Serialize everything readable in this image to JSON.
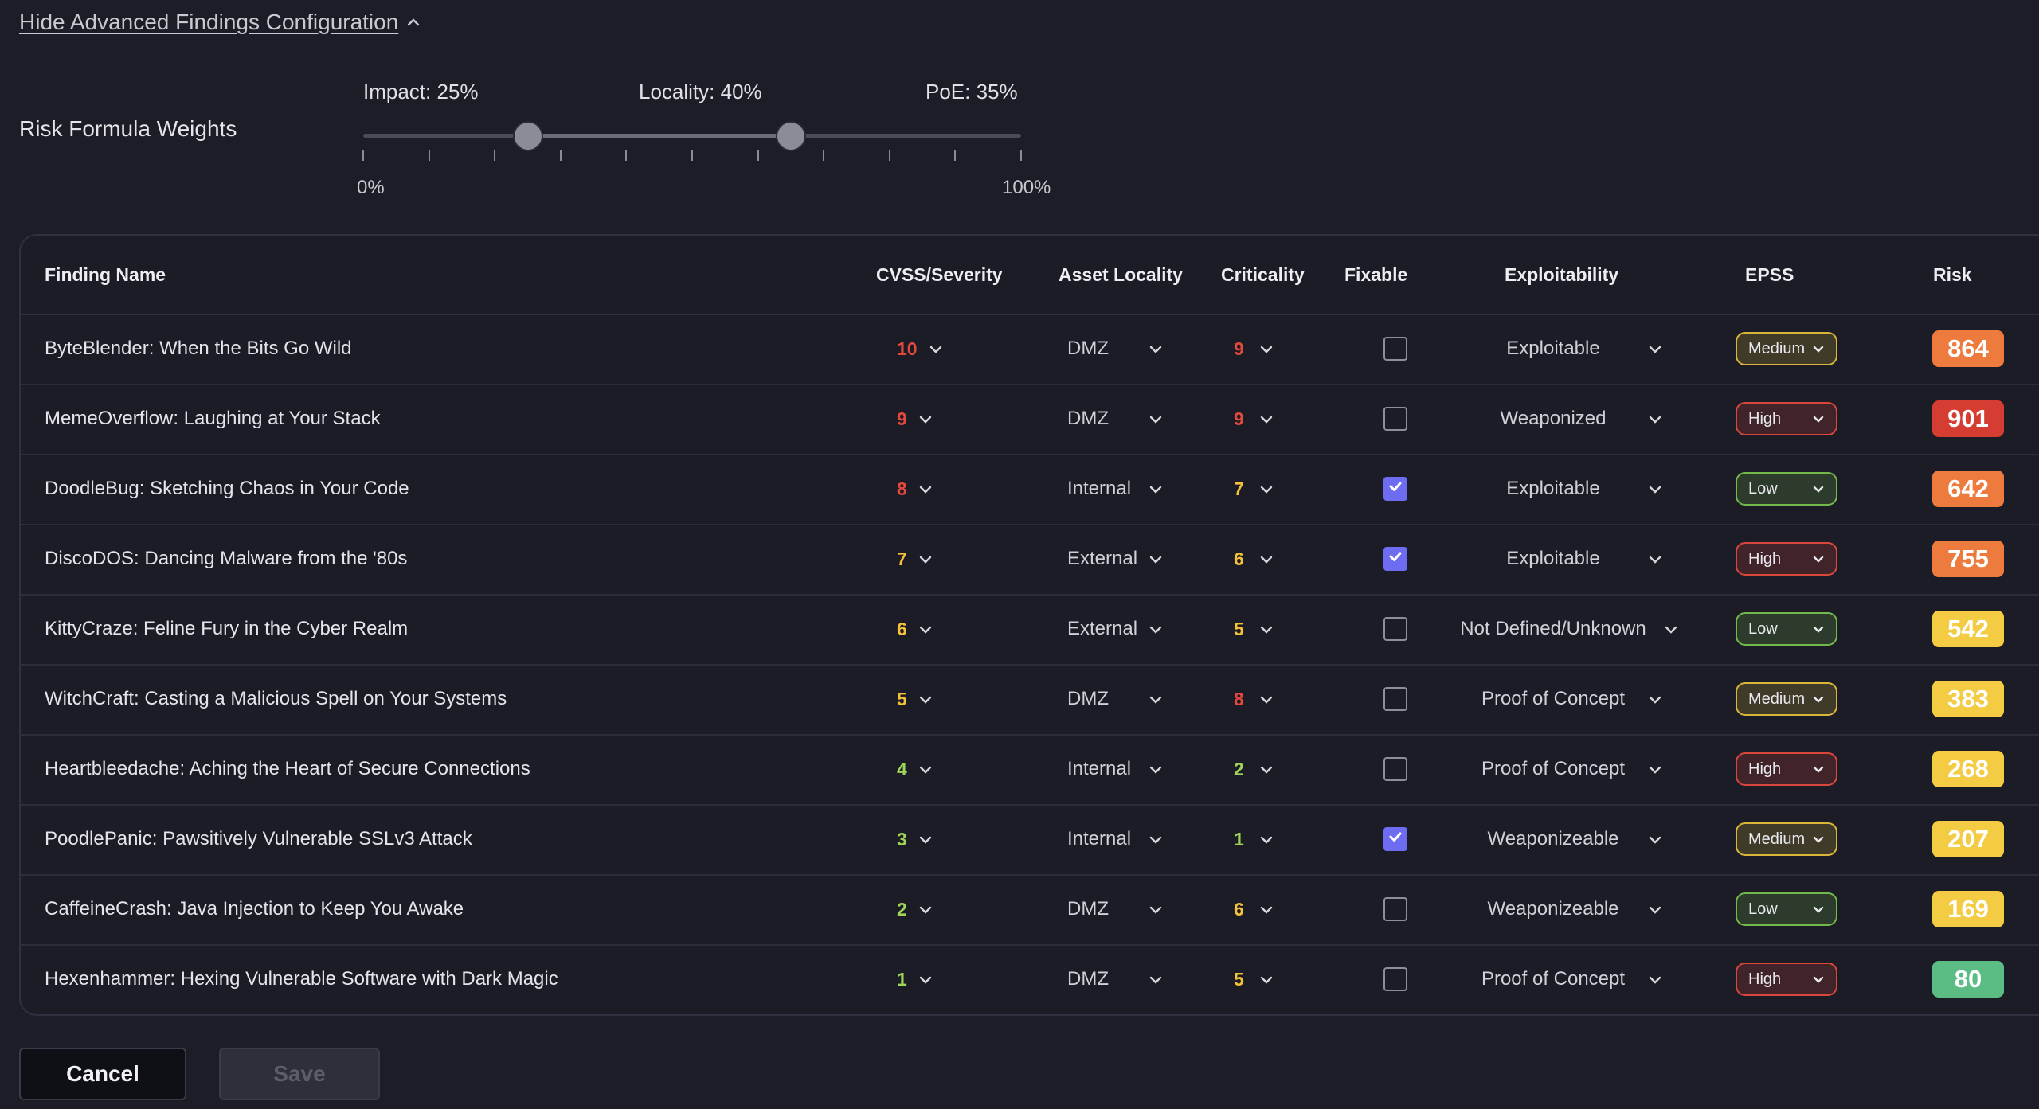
{
  "config_toggle": {
    "label": "Hide Advanced Findings Configuration",
    "icon": "chevron-up-icon"
  },
  "weights": {
    "title": "Risk Formula Weights",
    "impact_label": "Impact: 25%",
    "locality_label": "Locality: 40%",
    "poe_label": "PoE: 35%",
    "impact_pct": 25,
    "locality_pct": 40,
    "poe_pct": 35,
    "scale_min": "0%",
    "scale_max": "100%"
  },
  "columns": {
    "name": "Finding Name",
    "cvss": "CVSS/Severity",
    "locality": "Asset Locality",
    "criticality": "Criticality",
    "fixable": "Fixable",
    "exploitability": "Exploitability",
    "epss": "EPSS",
    "risk": "Risk"
  },
  "colors": {
    "red": "#e5483d",
    "orange": "#f08a3c",
    "yellow": "#f3c13a",
    "green": "#9fd35a",
    "checkbox": "#6e6cf0",
    "epss_medium": "#d9b53a",
    "epss_high": "#d8463c",
    "epss_low": "#72b94a",
    "risk_red": "#d53d33",
    "risk_orange": "#ee7b3e",
    "risk_yellow": "#f4cc43",
    "risk_green": "#5bbd84"
  },
  "findings": [
    {
      "name": "ByteBlender: When the Bits Go Wild",
      "cvss": "10",
      "cvss_color": "red",
      "locality": "DMZ",
      "criticality": "9",
      "crit_color": "red",
      "fixable": false,
      "exploitability": "Exploitable",
      "epss": "Medium",
      "epss_color": "epss_medium",
      "risk": "864",
      "risk_color": "risk_orange"
    },
    {
      "name": "MemeOverflow: Laughing at Your Stack",
      "cvss": "9",
      "cvss_color": "red",
      "locality": "DMZ",
      "criticality": "9",
      "crit_color": "red",
      "fixable": false,
      "exploitability": "Weaponized",
      "epss": "High",
      "epss_color": "epss_high",
      "risk": "901",
      "risk_color": "risk_red"
    },
    {
      "name": "DoodleBug: Sketching Chaos in Your Code",
      "cvss": "8",
      "cvss_color": "red",
      "locality": "Internal",
      "criticality": "7",
      "crit_color": "yellow",
      "fixable": true,
      "exploitability": "Exploitable",
      "epss": "Low",
      "epss_color": "epss_low",
      "risk": "642",
      "risk_color": "risk_orange"
    },
    {
      "name": "DiscoDOS: Dancing Malware from the '80s",
      "cvss": "7",
      "cvss_color": "yellow",
      "locality": "External",
      "criticality": "6",
      "crit_color": "yellow",
      "fixable": true,
      "exploitability": "Exploitable",
      "epss": "High",
      "epss_color": "epss_high",
      "risk": "755",
      "risk_color": "risk_orange"
    },
    {
      "name": "KittyCraze: Feline Fury in the Cyber Realm",
      "cvss": "6",
      "cvss_color": "yellow",
      "locality": "External",
      "criticality": "5",
      "crit_color": "yellow",
      "fixable": false,
      "exploitability": "Not Defined/Unknown",
      "epss": "Low",
      "epss_color": "epss_low",
      "risk": "542",
      "risk_color": "risk_yellow"
    },
    {
      "name": "WitchCraft: Casting a Malicious Spell on Your Systems",
      "cvss": "5",
      "cvss_color": "yellow",
      "locality": "DMZ",
      "criticality": "8",
      "crit_color": "red",
      "fixable": false,
      "exploitability": "Proof of Concept",
      "epss": "Medium",
      "epss_color": "epss_medium",
      "risk": "383",
      "risk_color": "risk_yellow"
    },
    {
      "name": "Heartbleedache: Aching the Heart of Secure Connections",
      "cvss": "4",
      "cvss_color": "green",
      "locality": "Internal",
      "criticality": "2",
      "crit_color": "green",
      "fixable": false,
      "exploitability": "Proof of Concept",
      "epss": "High",
      "epss_color": "epss_high",
      "risk": "268",
      "risk_color": "risk_yellow"
    },
    {
      "name": "PoodlePanic: Pawsitively Vulnerable SSLv3 Attack",
      "cvss": "3",
      "cvss_color": "green",
      "locality": "Internal",
      "criticality": "1",
      "crit_color": "green",
      "fixable": true,
      "exploitability": "Weaponizeable",
      "epss": "Medium",
      "epss_color": "epss_medium",
      "risk": "207",
      "risk_color": "risk_yellow"
    },
    {
      "name": "CaffeineCrash: Java Injection to Keep You Awake",
      "cvss": "2",
      "cvss_color": "green",
      "locality": "DMZ",
      "criticality": "6",
      "crit_color": "yellow",
      "fixable": false,
      "exploitability": "Weaponizeable",
      "epss": "Low",
      "epss_color": "epss_low",
      "risk": "169",
      "risk_color": "risk_yellow"
    },
    {
      "name": "Hexenhammer: Hexing Vulnerable Software with Dark Magic",
      "cvss": "1",
      "cvss_color": "green",
      "locality": "DMZ",
      "criticality": "5",
      "crit_color": "yellow",
      "fixable": false,
      "exploitability": "Proof of Concept",
      "epss": "High",
      "epss_color": "epss_high",
      "risk": "80",
      "risk_color": "risk_green"
    }
  ],
  "actions": {
    "cancel_label": "Cancel",
    "save_label": "Save"
  }
}
